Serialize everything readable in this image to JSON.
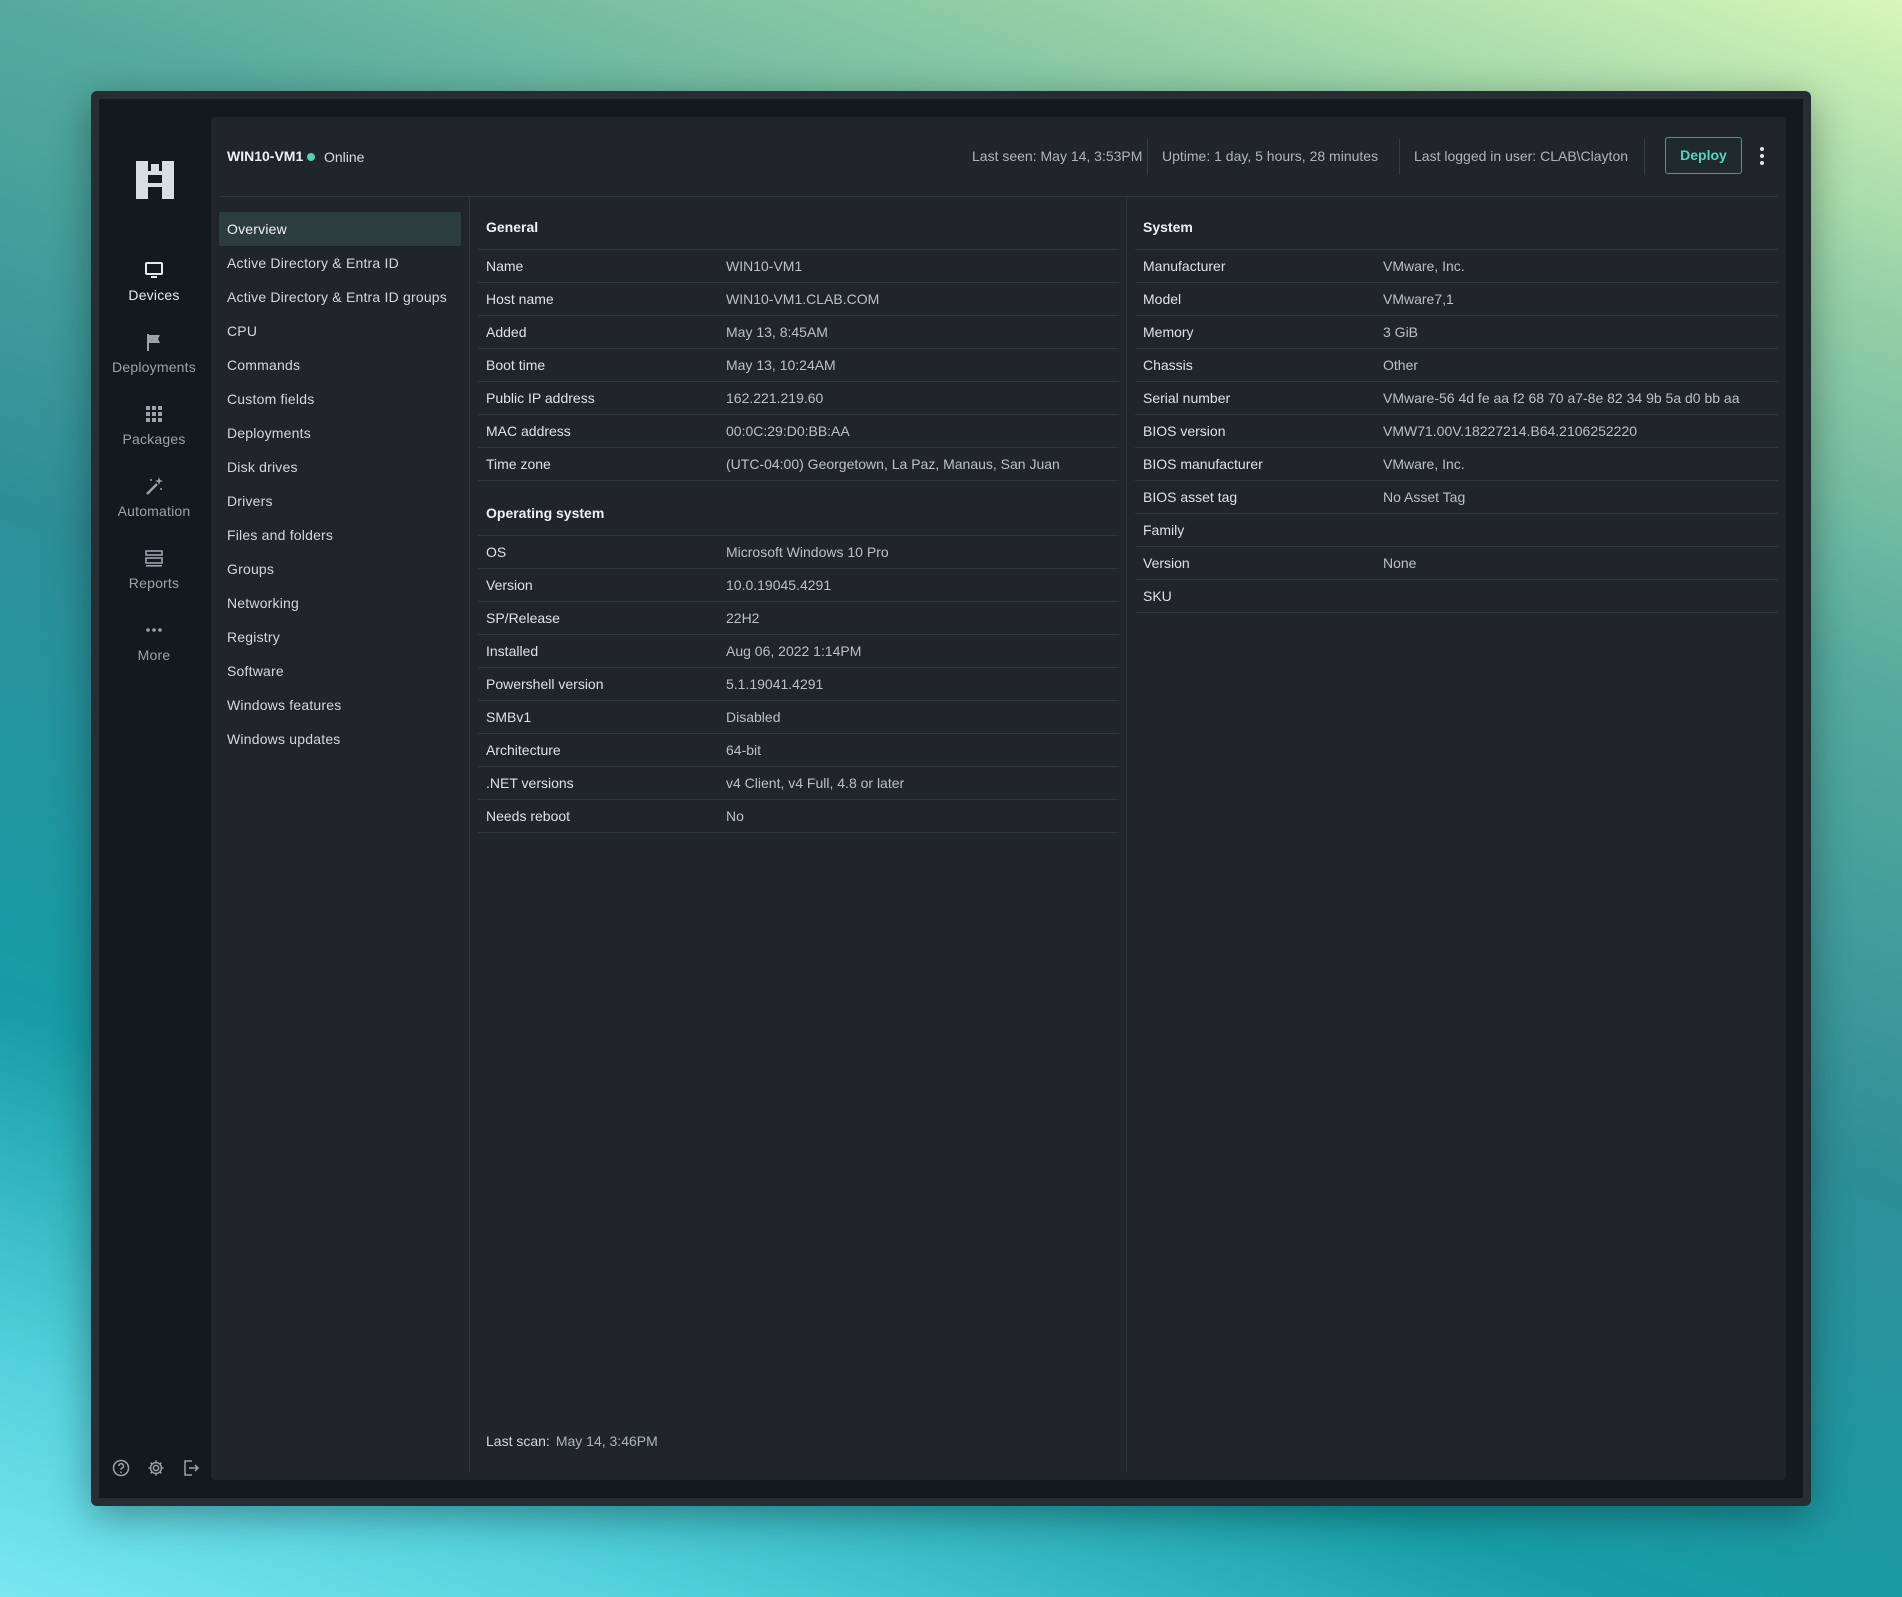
{
  "rail": {
    "items": [
      {
        "label": "Devices",
        "icon": "monitor-icon",
        "active": true
      },
      {
        "label": "Deployments",
        "icon": "flag-icon"
      },
      {
        "label": "Packages",
        "icon": "grid-icon"
      },
      {
        "label": "Automation",
        "icon": "magic-wand-icon"
      },
      {
        "label": "Reports",
        "icon": "reports-icon"
      },
      {
        "label": "More",
        "icon": "more-dots-icon"
      }
    ],
    "bottom_icons": [
      "help-icon",
      "settings-icon",
      "logout-icon"
    ]
  },
  "header": {
    "device_name": "WIN10-VM1",
    "status": "Online",
    "last_seen": "Last seen: May 14, 3:53PM",
    "uptime": "Uptime: 1 day, 5 hours, 28 minutes",
    "last_user": "Last logged in user: CLAB\\Clayton",
    "deploy_label": "Deploy",
    "status_color": "#4fd1b2",
    "accent_color": "#57d6bd"
  },
  "nav": {
    "items": [
      "Overview",
      "Active Directory & Entra ID",
      "Active Directory & Entra ID groups",
      "CPU",
      "Commands",
      "Custom fields",
      "Deployments",
      "Disk drives",
      "Drivers",
      "Files and folders",
      "Groups",
      "Networking",
      "Registry",
      "Software",
      "Windows features",
      "Windows updates"
    ],
    "active": "Overview"
  },
  "general": {
    "title": "General",
    "rows": [
      {
        "k": "Name",
        "v": "WIN10-VM1"
      },
      {
        "k": "Host name",
        "v": "WIN10-VM1.CLAB.COM"
      },
      {
        "k": "Added",
        "v": "May 13, 8:45AM"
      },
      {
        "k": "Boot time",
        "v": "May 13, 10:24AM"
      },
      {
        "k": "Public IP address",
        "v": "162.221.219.60"
      },
      {
        "k": "MAC address",
        "v": "00:0C:29:D0:BB:AA"
      },
      {
        "k": "Time zone",
        "v": "(UTC-04:00) Georgetown, La Paz, Manaus, San Juan"
      }
    ]
  },
  "os": {
    "title": "Operating system",
    "rows": [
      {
        "k": "OS",
        "v": "Microsoft Windows 10 Pro"
      },
      {
        "k": "Version",
        "v": "10.0.19045.4291"
      },
      {
        "k": "SP/Release",
        "v": "22H2"
      },
      {
        "k": "Installed",
        "v": "Aug 06, 2022 1:14PM"
      },
      {
        "k": "Powershell version",
        "v": "5.1.19041.4291"
      },
      {
        "k": "SMBv1",
        "v": "Disabled"
      },
      {
        "k": "Architecture",
        "v": "64-bit"
      },
      {
        "k": ".NET versions",
        "v": "v4 Client, v4 Full, 4.8 or later"
      },
      {
        "k": "Needs reboot",
        "v": "No"
      }
    ]
  },
  "system": {
    "title": "System",
    "rows": [
      {
        "k": "Manufacturer",
        "v": "VMware, Inc."
      },
      {
        "k": "Model",
        "v": "VMware7,1"
      },
      {
        "k": "Memory",
        "v": "3 GiB"
      },
      {
        "k": "Chassis",
        "v": "Other"
      },
      {
        "k": "Serial number",
        "v": "VMware-56 4d fe aa f2 68 70 a7-8e 82 34 9b 5a d0 bb aa"
      },
      {
        "k": "BIOS version",
        "v": "VMW71.00V.18227214.B64.2106252220"
      },
      {
        "k": "BIOS manufacturer",
        "v": "VMware, Inc."
      },
      {
        "k": "BIOS asset tag",
        "v": "No Asset Tag"
      },
      {
        "k": "Family",
        "v": ""
      },
      {
        "k": "Version",
        "v": "None"
      },
      {
        "k": "SKU",
        "v": ""
      }
    ]
  },
  "footer": {
    "last_scan_label": "Last scan:",
    "last_scan_value": "May 14, 3:46PM"
  }
}
